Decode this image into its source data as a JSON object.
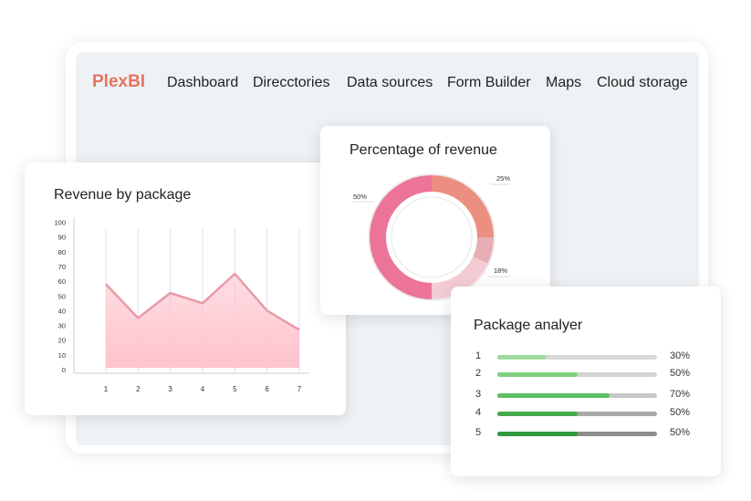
{
  "app": {
    "brand": "PlexBI",
    "nav": [
      "Dashboard",
      "Direcctories",
      "Data sources",
      "Form Builder",
      "Maps",
      "Cloud storage"
    ]
  },
  "revenue_card": {
    "title": "Revenue by package"
  },
  "percentage_card": {
    "title": "Percentage of revenue",
    "labels": [
      "25%",
      "50%",
      "18%"
    ]
  },
  "analyzer_card": {
    "title": "Package analyer",
    "rows": [
      {
        "index": "1",
        "percent": "30%",
        "value": 0.3,
        "color": "#9edb9b",
        "track": "#d9d9d9"
      },
      {
        "index": "2",
        "percent": "50%",
        "value": 0.5,
        "color": "#7fd07d",
        "track": "#d3d3d3"
      },
      {
        "index": "3",
        "percent": "70%",
        "value": 0.7,
        "color": "#5cbf61",
        "track": "#c8c8c8"
      },
      {
        "index": "4",
        "percent": "50%",
        "value": 0.5,
        "color": "#44ab4c",
        "track": "#a9a9a9"
      },
      {
        "index": "5",
        "percent": "50%",
        "value": 0.5,
        "color": "#2f9a3d",
        "track": "#8c8c8c"
      }
    ]
  },
  "chart_data": [
    {
      "type": "area",
      "title": "Revenue by package",
      "x": [
        1,
        2,
        3,
        4,
        5,
        6,
        7
      ],
      "values": [
        58,
        35,
        52,
        45,
        65,
        40,
        27
      ],
      "yticks": [
        0,
        10,
        20,
        30,
        40,
        50,
        60,
        70,
        80,
        90,
        100
      ],
      "ylim": [
        0,
        100
      ],
      "color": "#e89aa6",
      "fill": "#ffc3cd"
    },
    {
      "type": "pie",
      "title": "Percentage of revenue",
      "slices": [
        {
          "label": "25%",
          "value": 25,
          "color": "#ec8f80"
        },
        {
          "label": "",
          "value": 7,
          "color": "#e6aeb4"
        },
        {
          "label": "18%",
          "value": 18,
          "color": "#f2ccd2"
        },
        {
          "label": "50%",
          "value": 50,
          "color": "#ec7496"
        }
      ]
    }
  ]
}
